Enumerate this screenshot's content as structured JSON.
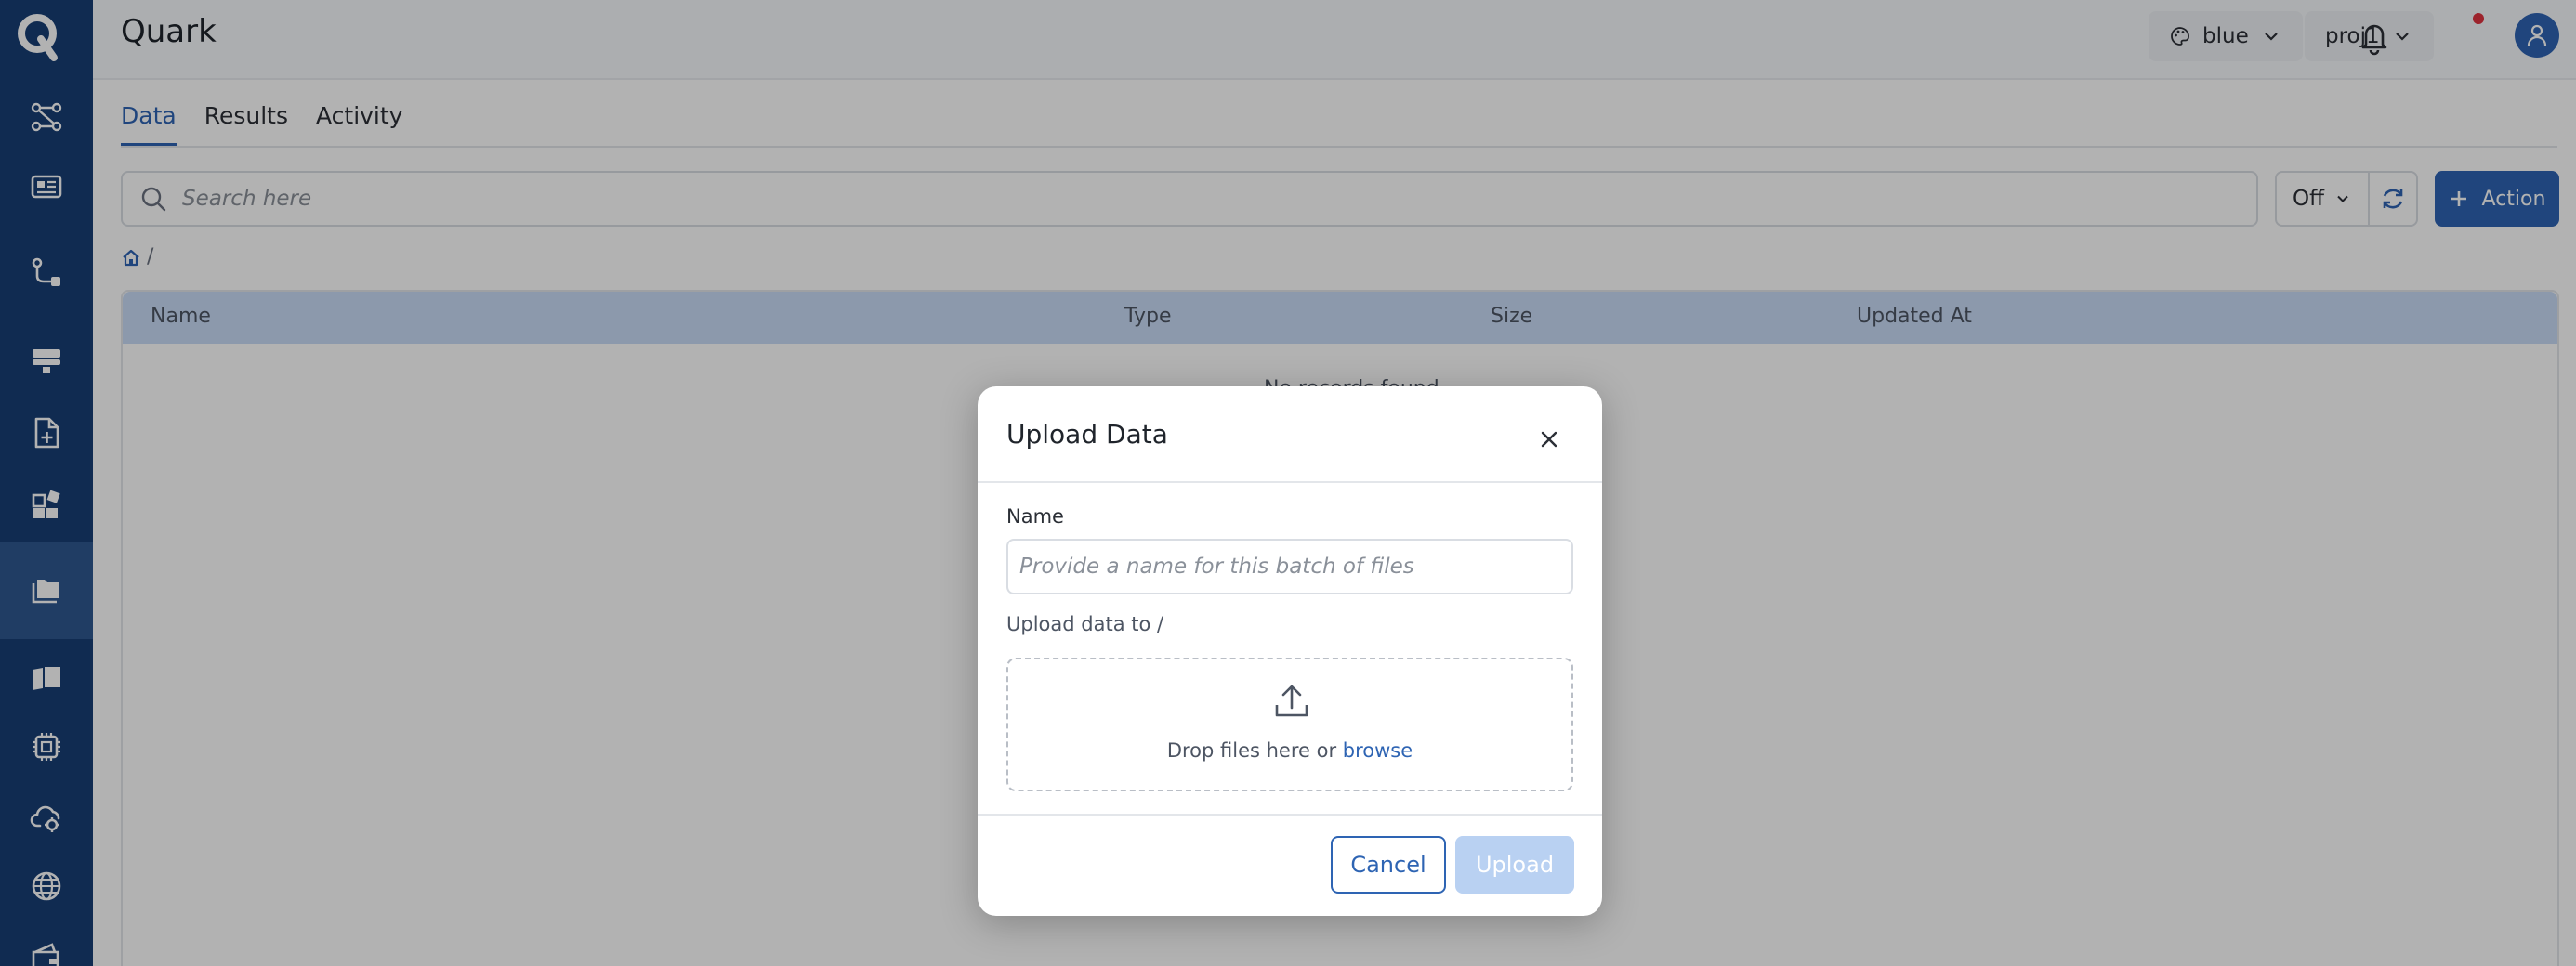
{
  "app": {
    "title": "Quark"
  },
  "header": {
    "theme_label": "blue",
    "project_label": "proj1"
  },
  "sidebar": {
    "items": [
      {
        "name": "workflow",
        "icon": "workflow-icon"
      },
      {
        "name": "dashboard",
        "icon": "dashboard-card-icon"
      },
      {
        "name": "pipeline",
        "icon": "pipeline-icon"
      },
      {
        "name": "storage",
        "icon": "server-stack-icon"
      },
      {
        "name": "new-file",
        "icon": "file-plus-icon"
      },
      {
        "name": "widgets",
        "icon": "widgets-icon"
      },
      {
        "name": "data",
        "icon": "folder-icon",
        "active": true
      },
      {
        "name": "docs",
        "icon": "book-icon"
      },
      {
        "name": "compute",
        "icon": "chip-icon"
      },
      {
        "name": "cloud-settings",
        "icon": "cloud-gear-icon"
      },
      {
        "name": "network",
        "icon": "globe-icon"
      },
      {
        "name": "wallet",
        "icon": "wallet-icon"
      }
    ]
  },
  "tabs": [
    {
      "label": "Data",
      "active": true
    },
    {
      "label": "Results",
      "active": false
    },
    {
      "label": "Activity",
      "active": false
    }
  ],
  "toolbar": {
    "search_placeholder": "Search here",
    "filter_value": "Off",
    "action_label": "Action"
  },
  "breadcrumb": {
    "separator": "/"
  },
  "table": {
    "columns": [
      "Name",
      "Type",
      "Size",
      "Updated At"
    ],
    "empty_text": "No records found"
  },
  "modal": {
    "title": "Upload Data",
    "name_label": "Name",
    "name_placeholder": "Provide a name for this batch of files",
    "upload_to": "Upload data to /",
    "drop_text": "Drop files here or ",
    "browse_label": "browse",
    "cancel_label": "Cancel",
    "upload_label": "Upload"
  },
  "colors": {
    "sidebar": "#173e75",
    "accent": "#2e64b3",
    "table_header": "#c9dcf7",
    "upload_disabled": "#b9d1f2",
    "notification_dot": "#e0333f"
  }
}
